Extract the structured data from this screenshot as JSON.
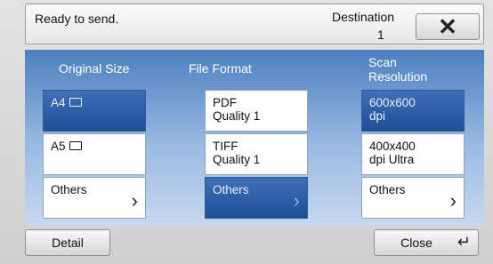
{
  "status": {
    "message": "Ready to send.",
    "destination_label": "Destination",
    "destination_count": "1",
    "close_icon": "close-icon"
  },
  "columns": [
    {
      "header": "Original Size",
      "options": [
        {
          "label": "A4",
          "selected": true
        },
        {
          "label": "A5",
          "selected": false
        },
        {
          "label": "Others",
          "selected": false
        }
      ]
    },
    {
      "header": "File Format",
      "options": [
        {
          "label": "PDF",
          "label2": "Quality 1",
          "selected": false
        },
        {
          "label": "TIFF",
          "label2": "Quality 1",
          "selected": false
        },
        {
          "label": "Others",
          "selected": true
        }
      ]
    },
    {
      "header_line1": "Scan",
      "header_line2": "Resolution",
      "options": [
        {
          "label": "600x600",
          "label2": "dpi",
          "selected": true
        },
        {
          "label": "400x400",
          "label2": "dpi Ultra",
          "selected": false
        },
        {
          "label": "Others",
          "selected": false
        }
      ]
    }
  ],
  "footer": {
    "detail_label": "Detail",
    "close_label": "Close"
  },
  "colors": {
    "panel_top": "#4d7fbf",
    "selected": "#2f5fa5"
  }
}
